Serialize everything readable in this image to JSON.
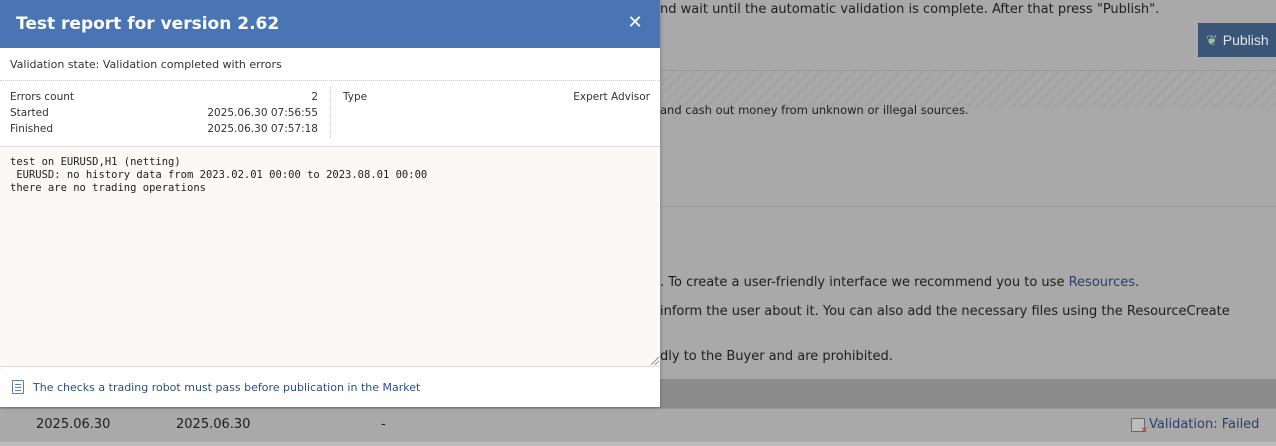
{
  "background": {
    "top_text": "nd wait until the automatic validation is complete. After that press \"Publish\".",
    "publish_label": "Publish",
    "text2": "and cash out money from unknown or illegal sources.",
    "text3_prefix": ". To create a user-friendly interface we recommend you to use ",
    "text3_link": "Resources",
    "text3_suffix": ".",
    "text4": " inform the user about it. You can also add the necessary files using the ResourceCreate",
    "text5": "dly to the Buyer and are prohibited.",
    "row": {
      "date1": "2025.06.30",
      "date2": "2025.06.30",
      "dash": "-",
      "status": "Validation: Failed"
    }
  },
  "modal": {
    "title": "Test report for version 2.62",
    "close_symbol": "✕",
    "validation_state": "Validation state: Validation completed with errors",
    "info": {
      "errors_label": "Errors count",
      "errors_value": "2",
      "started_label": "Started",
      "started_value": "2025.06.30 07:56:55",
      "finished_label": "Finished",
      "finished_value": "2025.06.30 07:57:18",
      "type_label": "Type",
      "type_value": "Expert Advisor"
    },
    "log": "test on EURUSD,H1 (netting)\n EURUSD: no history data from 2023.02.01 00:00 to 2023.08.01 00:00\nthere are no trading operations",
    "footer_link": "The checks a trading robot must pass before publication in the Market"
  },
  "colors": {
    "header": "#4a75b5",
    "overlay": "#a9a9a9",
    "link": "#2e4f86"
  }
}
